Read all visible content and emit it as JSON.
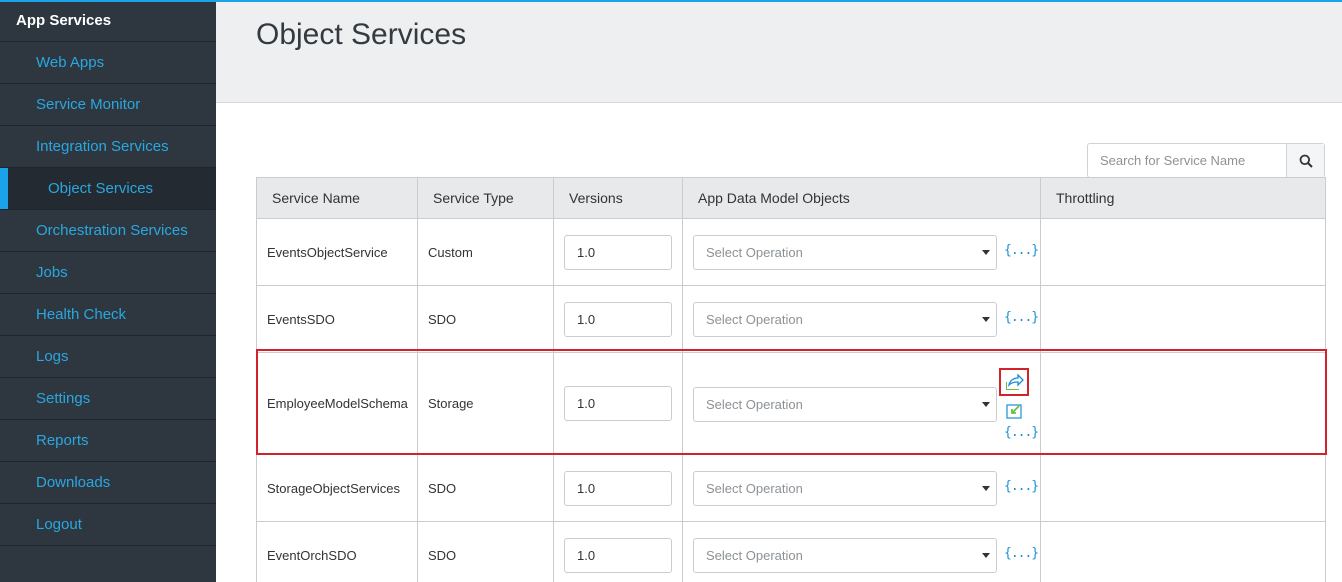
{
  "sidebar": {
    "title": "App Services",
    "items": [
      {
        "label": "Web Apps"
      },
      {
        "label": "Service Monitor"
      },
      {
        "label": "Integration Services"
      },
      {
        "label": "Object Services"
      },
      {
        "label": "Orchestration Services"
      },
      {
        "label": "Jobs"
      },
      {
        "label": "Health Check"
      },
      {
        "label": "Logs"
      },
      {
        "label": "Settings"
      },
      {
        "label": "Reports"
      },
      {
        "label": "Downloads"
      },
      {
        "label": "Logout"
      }
    ],
    "active_item": "Object Services"
  },
  "page": {
    "title": "Object Services"
  },
  "search": {
    "placeholder": "Search for Service Name",
    "icon": "search-icon"
  },
  "table": {
    "headers": [
      "Service Name",
      "Service Type",
      "Versions",
      "App Data Model Objects",
      "Throttling"
    ],
    "rows": [
      {
        "name": "EventsObjectService",
        "type": "Custom",
        "version": "1.0",
        "operation": "Select Operation",
        "braces": "{...}"
      },
      {
        "name": "EventsSDO",
        "type": "SDO",
        "version": "1.0",
        "operation": "Select Operation",
        "braces": "{...}"
      },
      {
        "name": "EmployeeModelSchema",
        "type": "Storage",
        "version": "1.0",
        "operation": "Select Operation",
        "braces": "{...}"
      },
      {
        "name": "StorageObjectServices",
        "type": "SDO",
        "version": "1.0",
        "operation": "Select Operation",
        "braces": "{...}"
      },
      {
        "name": "EventOrchSDO",
        "type": "SDO",
        "version": "1.0",
        "operation": "Select Operation",
        "braces": "{...}"
      }
    ]
  },
  "colors": {
    "accent": "#1aa3e8",
    "sidebar_bg": "#2e3640",
    "link": "#29a8e0",
    "highlight": "#d2232a"
  }
}
